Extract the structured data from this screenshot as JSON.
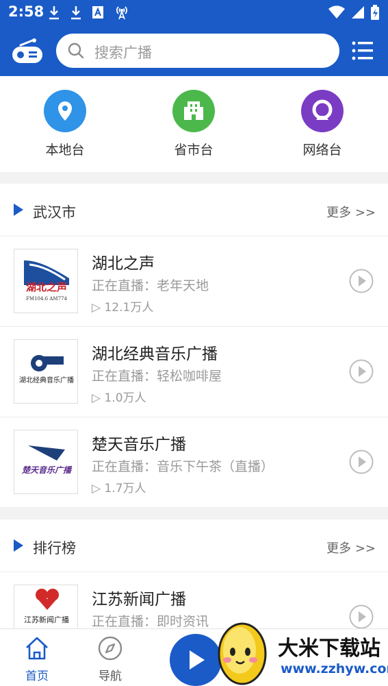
{
  "status_bar": {
    "time": "2:58"
  },
  "header": {
    "search_placeholder": "搜索广播",
    "icons": {
      "logo": "radio-icon",
      "search": "search-icon",
      "menu": "menu-list-icon"
    }
  },
  "categories": [
    {
      "label": "本地台",
      "icon": "location-pin-icon",
      "color": "#2f93e8"
    },
    {
      "label": "省市台",
      "icon": "building-icon",
      "color": "#4cb84c"
    },
    {
      "label": "网络台",
      "icon": "globe-network-icon",
      "color": "#7b3cc4"
    }
  ],
  "sections": [
    {
      "title": "武汉市",
      "more": "更多 >>",
      "stations": [
        {
          "name": "湖北之声",
          "live": "正在直播：老年天地",
          "listeners": "▷ 12.1万人",
          "logo_text": "湖北之声",
          "logo_sub": "FM104.6 AM774"
        },
        {
          "name": "湖北经典音乐广播",
          "live": "正在直播：轻松咖啡屋",
          "listeners": "▷ 1.0万人",
          "logo_text": "湖北经典音乐广播"
        },
        {
          "name": "楚天音乐广播",
          "live": "正在直播：音乐下午茶（直播）",
          "listeners": "▷ 1.7万人",
          "logo_text": "楚天音乐广播"
        }
      ]
    },
    {
      "title": "排行榜",
      "more": "更多 >>",
      "stations": [
        {
          "name": "江苏新闻广播",
          "live": "正在直播：即时资讯",
          "logo_text": "江苏新闻广播"
        }
      ]
    }
  ],
  "bottom_nav": {
    "home_label": "首页",
    "guide_label": "导航",
    "accent_color": "#1a5bc7"
  },
  "watermark": {
    "title": "大米下载站",
    "url": "www.zzhyw.com"
  }
}
